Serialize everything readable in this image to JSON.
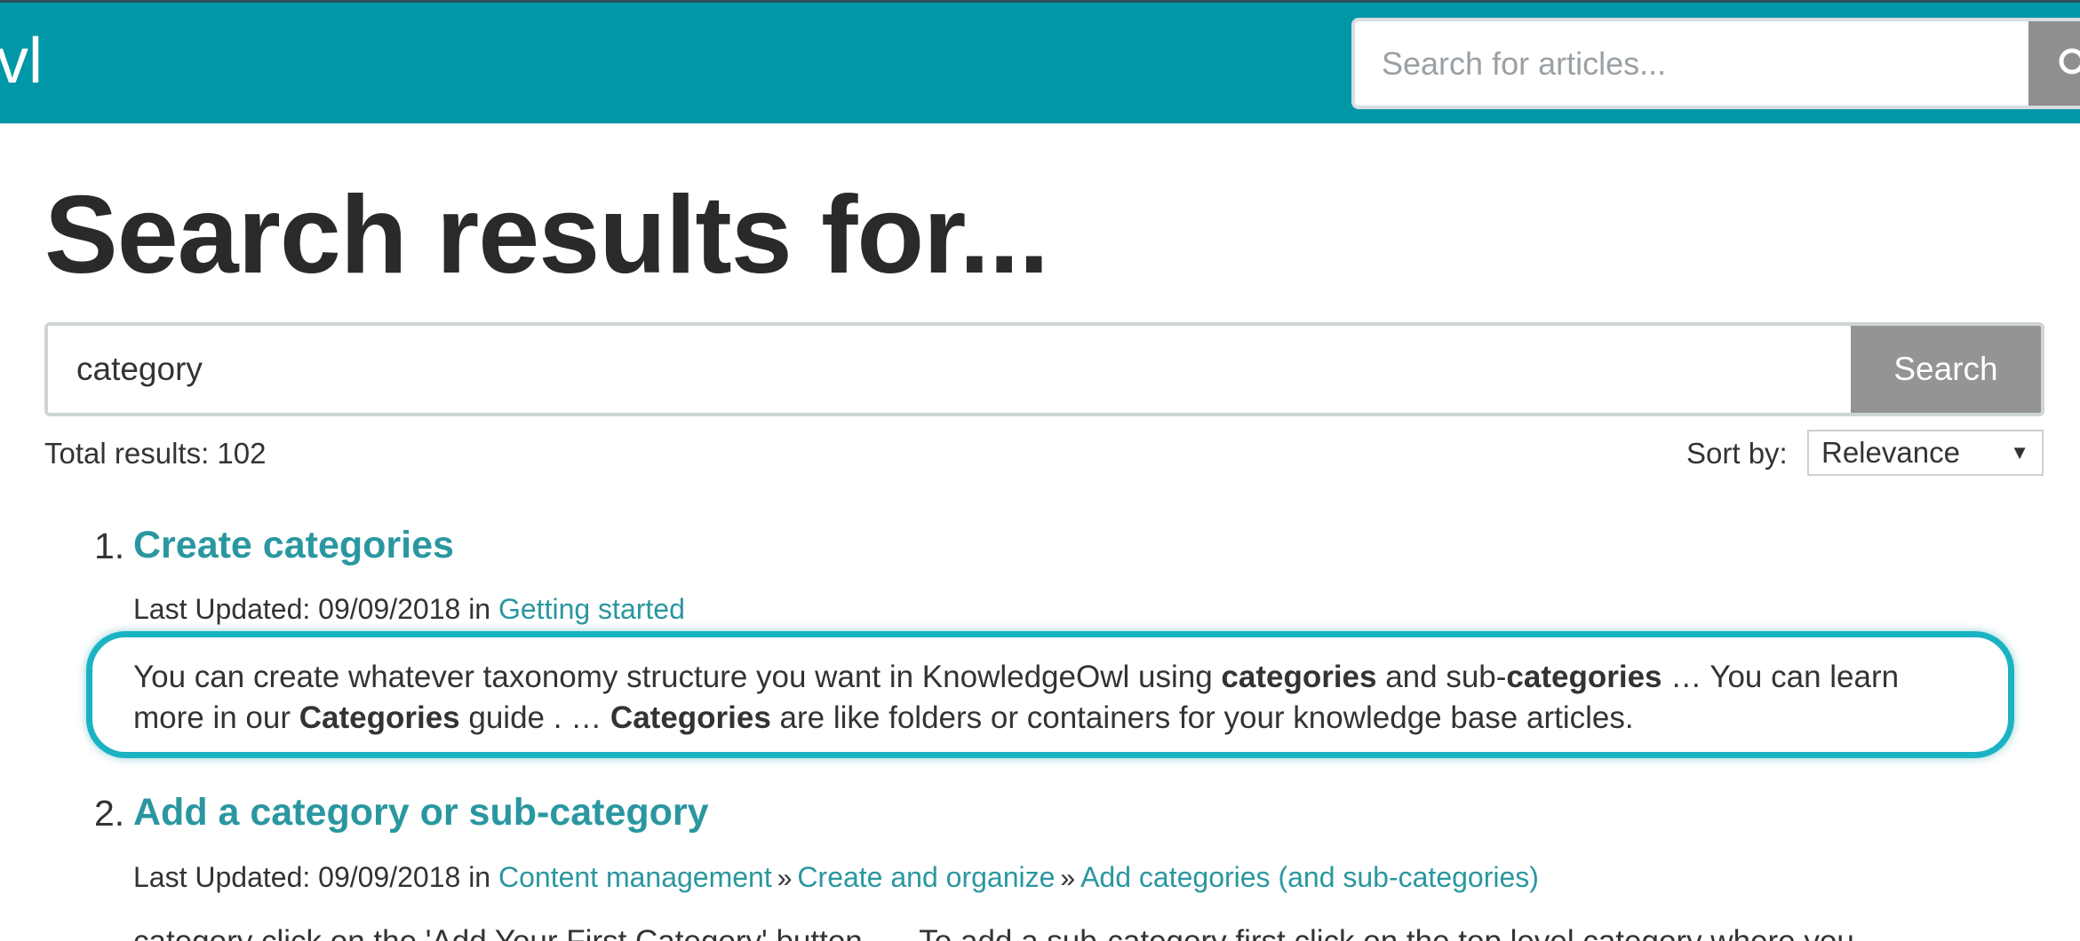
{
  "header": {
    "logo_fragment": "vl",
    "search_placeholder": "Search for articles..."
  },
  "page_title": "Search results for...",
  "search": {
    "value": "category",
    "button_label": "Search"
  },
  "results_meta": {
    "total_label": "Total results: 102",
    "sort_label": "Sort by:",
    "sort_value": "Relevance"
  },
  "results": [
    {
      "number": "1.",
      "title": "Create categories",
      "updated_prefix": "Last Updated: 09/09/2018 in",
      "breadcrumbs": [
        "Getting started"
      ],
      "snippet": {
        "line1_a": "You can create whatever taxonomy structure you want in KnowledgeOwl using ",
        "line1_b": "categories",
        "line1_c": " and sub-",
        "line1_d": "categories",
        "line1_e": " … You can learn",
        "line2_a": "more in our ",
        "line2_b": "Categories",
        "line2_c": " guide . … ",
        "line2_d": "Categories",
        "line2_e": " are like folders or containers for your knowledge base articles."
      }
    },
    {
      "number": "2.",
      "title": "Add a category or sub-category",
      "updated_prefix": "Last Updated: 09/09/2018 in",
      "breadcrumbs": [
        "Content management",
        "Create and organize",
        "Add categories (and sub-categories)"
      ],
      "separator": "»",
      "snippet_partial": "category click on the 'Add Your First Category' button. … To add a sub-category first click on the top level category where you"
    }
  ],
  "colors": {
    "header_bg": "#0097a7",
    "link": "#2a97a0",
    "highlight_outline": "#1ab3c3",
    "button_gray": "#949494"
  }
}
